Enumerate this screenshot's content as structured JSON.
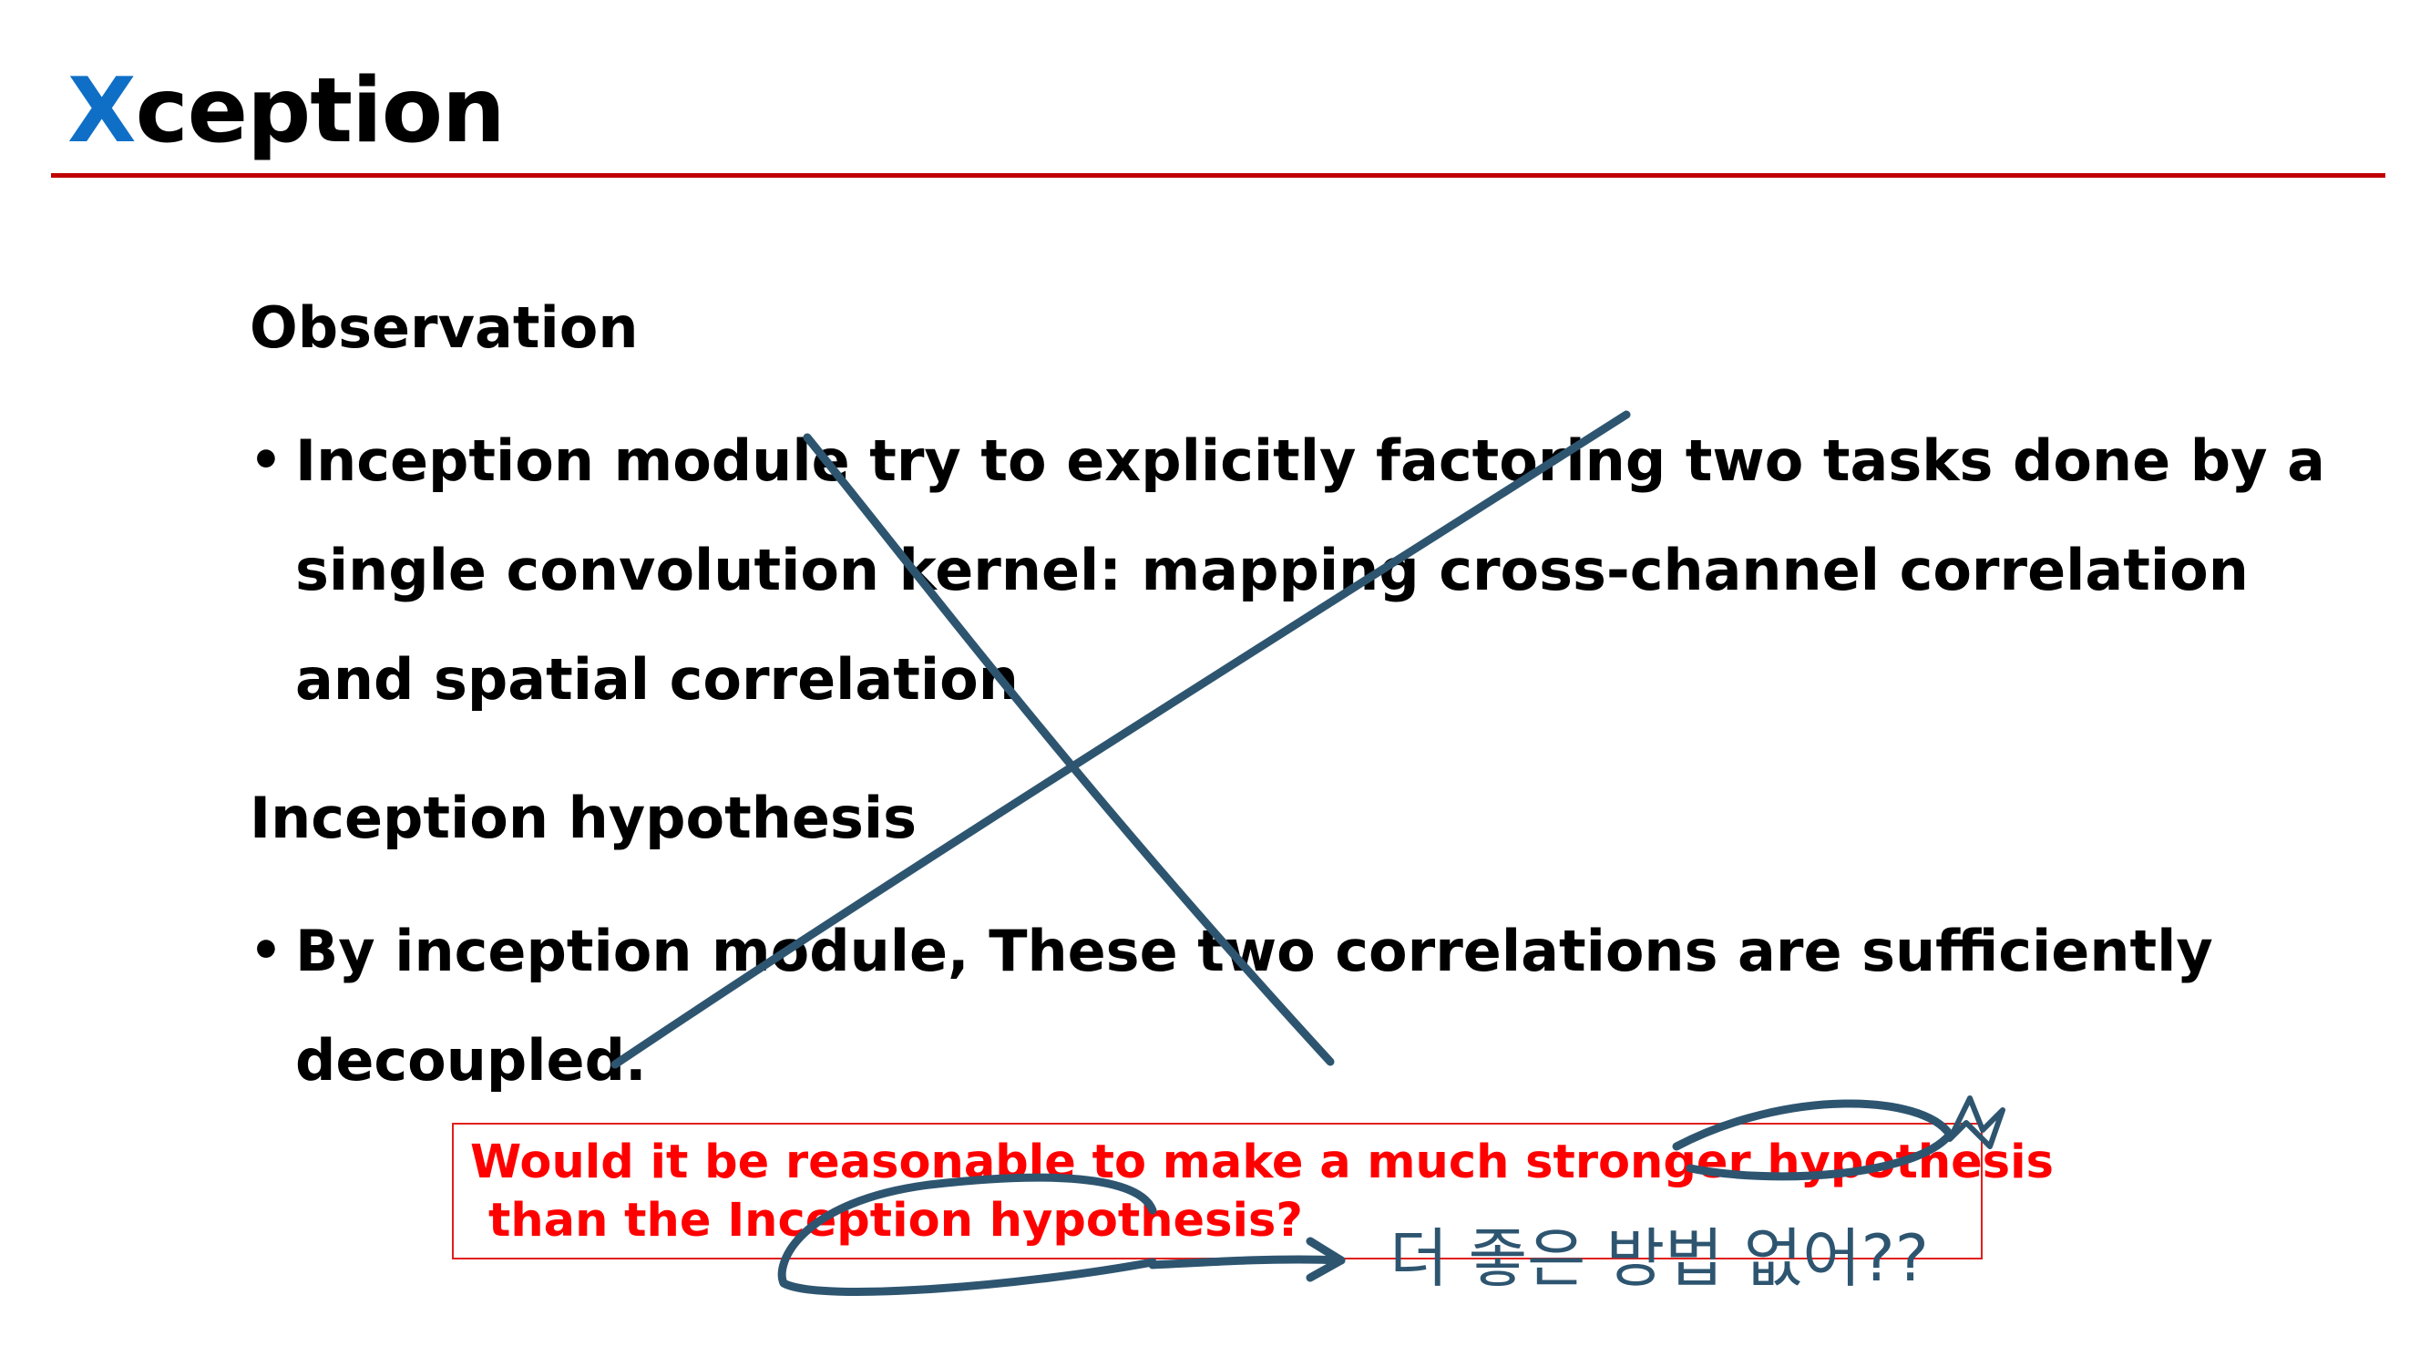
{
  "title": {
    "accent": "X",
    "rest": "ception"
  },
  "sections": {
    "observation": {
      "heading": "Observation",
      "bullet_lines": [
        "Inception module try to explicitly factoring two tasks done by a",
        "single convolution kernel: mapping cross-channel correlation",
        "and spatial correlation"
      ]
    },
    "hypothesis": {
      "heading": "Inception hypothesis",
      "bullet_lines": [
        "By inception module, These two correlations are sufficiently",
        "decoupled."
      ]
    }
  },
  "bullet_symbol": "•",
  "callout": {
    "lines": [
      "Would it be reasonable to make a much stronger hypothesis",
      "than the Inception hypothesis?"
    ]
  },
  "handwriting": {
    "note": "더 좋은 방법 없어??",
    "ink_color": "#2e5570"
  },
  "colors": {
    "title_accent": "#0f6fc6",
    "title_rule": "#c00000",
    "callout_text": "#ff0000",
    "callout_border": "#e0201b"
  }
}
